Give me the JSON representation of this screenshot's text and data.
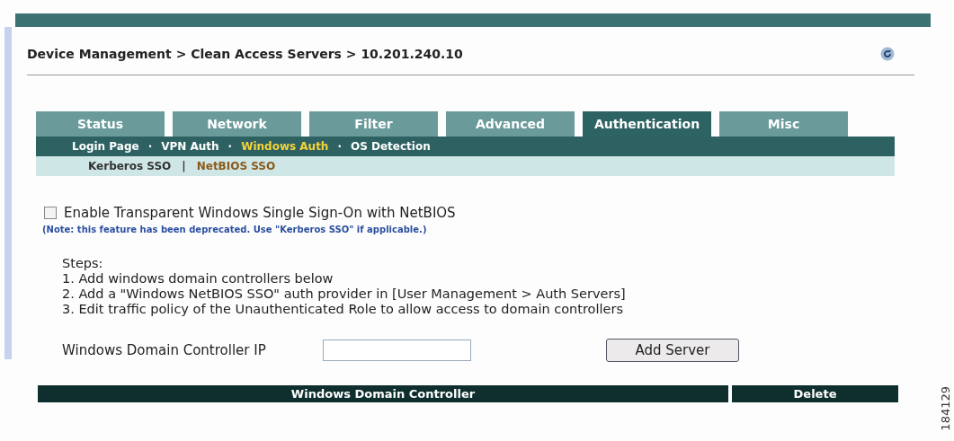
{
  "breadcrumb": "Device Management > Clean Access Servers > 10.201.240.10",
  "tabs": [
    {
      "label": "Status",
      "selected": false
    },
    {
      "label": "Network",
      "selected": false
    },
    {
      "label": "Filter",
      "selected": false
    },
    {
      "label": "Advanced",
      "selected": false
    },
    {
      "label": "Authentication",
      "selected": true
    },
    {
      "label": "Misc",
      "selected": false
    }
  ],
  "subtabs": [
    {
      "label": "Login Page",
      "selected": false
    },
    {
      "label": "VPN Auth",
      "selected": false
    },
    {
      "label": "Windows Auth",
      "selected": true
    },
    {
      "label": "OS Detection",
      "selected": false
    }
  ],
  "subtab_separator": "·",
  "sso_tabs": [
    {
      "label": "Kerberos SSO",
      "selected": false
    },
    {
      "label": "NetBIOS SSO",
      "selected": true
    }
  ],
  "sso_separator": "|",
  "enable_option": {
    "label": "Enable Transparent Windows Single Sign-On with NetBIOS",
    "checked": false
  },
  "note": "(Note: this feature has been deprecated. Use \"Kerberos SSO\" if applicable.)",
  "steps_title": "Steps:",
  "steps": [
    "1. Add windows domain controllers below",
    "2. Add a \"Windows NetBIOS SSO\" auth provider in [User Management > Auth Servers]",
    "3. Edit traffic policy of the Unauthenticated Role to allow access to domain controllers"
  ],
  "ip_field": {
    "label": "Windows Domain Controller IP"
  },
  "add_button": "Add Server",
  "table": {
    "columns": [
      "Windows Domain Controller",
      "Delete"
    ]
  },
  "figure_id": "184129"
}
